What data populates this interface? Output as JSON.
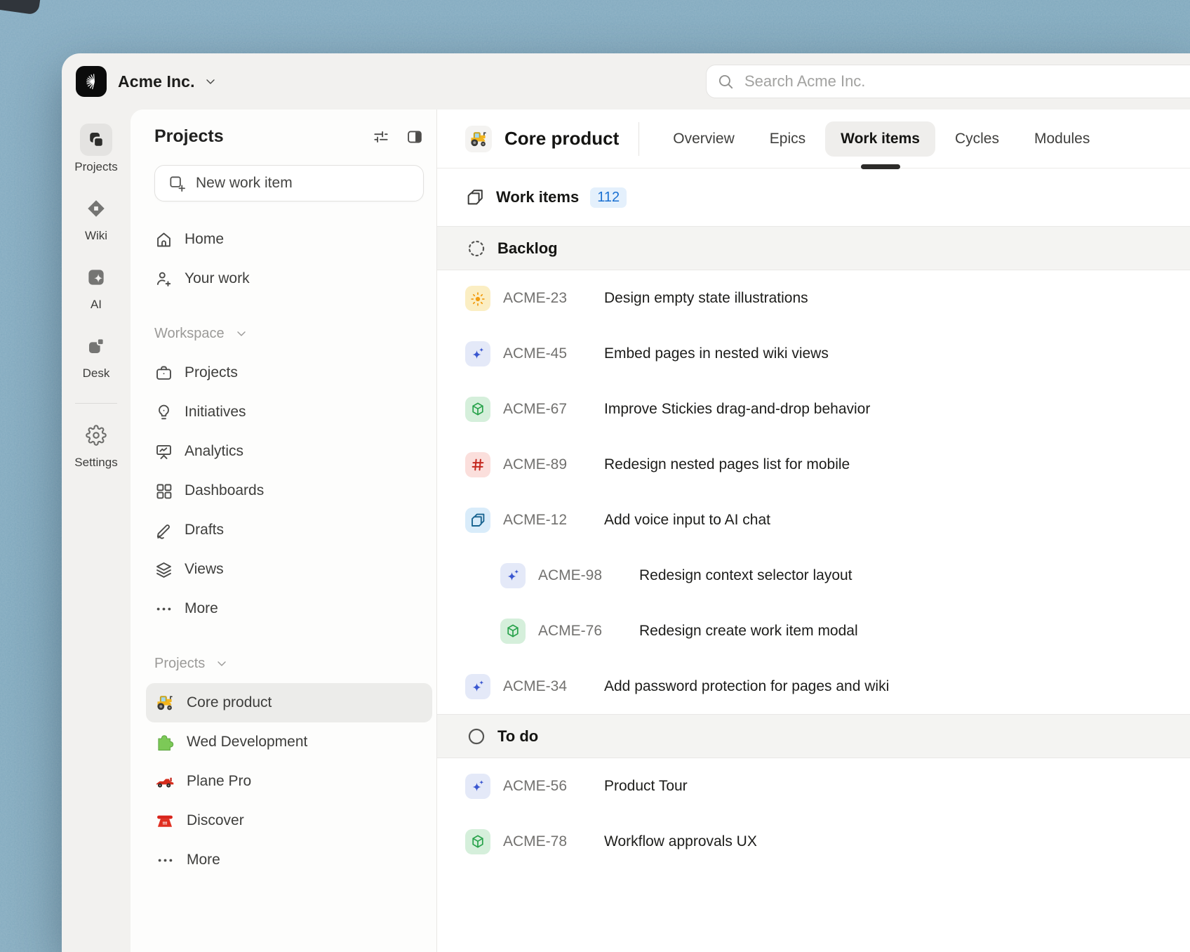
{
  "topbar": {
    "workspace_name": "Acme Inc.",
    "workspace_chevron_icon": "chevron-down-icon",
    "logo_icon": "acme-logo-icon",
    "search_placeholder": "Search Acme Inc.",
    "search_icon": "search-icon"
  },
  "rail": {
    "items": [
      {
        "label": "Projects",
        "icon": "projects-tile-icon",
        "active": true
      },
      {
        "label": "Wiki",
        "icon": "wiki-diamond-icon",
        "active": false
      },
      {
        "label": "AI",
        "icon": "ai-tile-icon",
        "active": false
      },
      {
        "label": "Desk",
        "icon": "desk-tile-icon",
        "active": false
      }
    ],
    "settings": {
      "label": "Settings",
      "icon": "gear-icon"
    }
  },
  "sidebar": {
    "title": "Projects",
    "display_settings_icon": "sliders-icon",
    "panel_toggle_icon": "panel-toggle-icon",
    "new_work_item_label": "New work item",
    "new_work_item_icon": "square-plus-icon",
    "nav": [
      {
        "label": "Home",
        "icon": "home-icon"
      },
      {
        "label": "Your work",
        "icon": "user-plus-icon"
      }
    ],
    "sections": [
      {
        "label": "Workspace",
        "chevron_icon": "chevron-down-icon",
        "items": [
          {
            "label": "Projects",
            "icon": "briefcase-icon"
          },
          {
            "label": "Initiatives",
            "icon": "lightbulb-icon"
          },
          {
            "label": "Analytics",
            "icon": "presentation-chart-icon"
          },
          {
            "label": "Dashboards",
            "icon": "grid-icon"
          },
          {
            "label": "Drafts",
            "icon": "pen-icon"
          },
          {
            "label": "Views",
            "icon": "layers-icon"
          },
          {
            "label": "More",
            "icon": "ellipsis-icon"
          }
        ]
      },
      {
        "label": "Projects",
        "chevron_icon": "chevron-down-icon",
        "items": [
          {
            "label": "Core product",
            "icon": "tractor-icon",
            "active": true
          },
          {
            "label": "Wed Development",
            "icon": "puzzle-icon"
          },
          {
            "label": "Plane Pro",
            "icon": "racecar-icon"
          },
          {
            "label": "Discover",
            "icon": "phone-icon"
          },
          {
            "label": "More",
            "icon": "ellipsis-icon"
          }
        ]
      }
    ]
  },
  "main": {
    "project_name": "Core product",
    "project_icon": "tractor-icon",
    "tabs": [
      {
        "label": "Overview",
        "active": false
      },
      {
        "label": "Epics",
        "active": false
      },
      {
        "label": "Work items",
        "active": true
      },
      {
        "label": "Cycles",
        "active": false
      },
      {
        "label": "Modules",
        "active": false
      }
    ],
    "work_items_header": {
      "label": "Work items",
      "count": "112",
      "icon": "stacked-pages-icon"
    },
    "groups": [
      {
        "label": "Backlog",
        "icon": "dashed-circle-icon",
        "items": [
          {
            "id": "ACME-23",
            "title": "Design empty state illustrations",
            "type_icon": "sun-icon",
            "indent": false
          },
          {
            "id": "ACME-45",
            "title": "Embed pages in nested wiki views",
            "type_icon": "sparkles-icon",
            "indent": false
          },
          {
            "id": "ACME-67",
            "title": "Improve Stickies drag-and-drop behavior",
            "type_icon": "cube-icon",
            "indent": false
          },
          {
            "id": "ACME-89",
            "title": "Redesign nested pages list for mobile",
            "type_icon": "hash-icon",
            "indent": false
          },
          {
            "id": "ACME-12",
            "title": "Add voice input to AI chat",
            "type_icon": "pages-icon",
            "indent": false
          },
          {
            "id": "ACME-98",
            "title": "Redesign context selector layout",
            "type_icon": "sparkles-icon",
            "indent": true
          },
          {
            "id": "ACME-76",
            "title": "Redesign create work item modal",
            "type_icon": "cube-icon",
            "indent": true
          },
          {
            "id": "ACME-34",
            "title": "Add password protection for pages and wiki",
            "type_icon": "sparkles-icon",
            "indent": false
          }
        ]
      },
      {
        "label": "To do",
        "icon": "circle-icon",
        "items": [
          {
            "id": "ACME-56",
            "title": "Product Tour",
            "type_icon": "sparkles-icon",
            "indent": false
          },
          {
            "id": "ACME-78",
            "title": "Workflow approvals UX",
            "type_icon": "cube-icon",
            "indent": false
          }
        ]
      }
    ]
  },
  "colors": {
    "accent_count_text": "#1a70d2",
    "accent_count_bg": "#e4f0fc",
    "tile_sun_bg": "#fbeec3",
    "tile_sun_glyph": "#f29d12",
    "tile_sparkles_bg": "#e4e9f8",
    "tile_sparkles_glyph": "#3a57d0",
    "tile_cube_bg": "#d5efdb",
    "tile_cube_glyph": "#27a24a",
    "tile_hash_bg": "#fbdfdc",
    "tile_hash_glyph": "#c4281f",
    "tile_pages_bg": "#d9ecfa",
    "tile_pages_glyph": "#1a6591",
    "desktop_bg": "#84abc1",
    "window_frame_bg": "#f2f1ef",
    "surface_bg": "#ffffff"
  }
}
